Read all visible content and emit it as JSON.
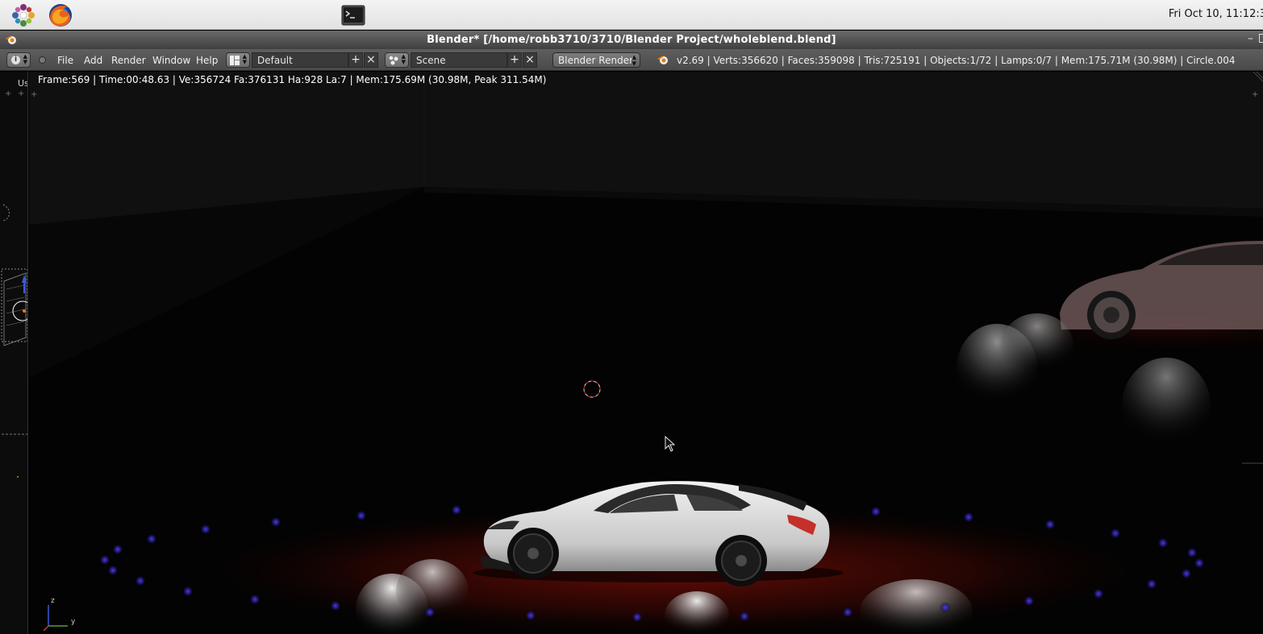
{
  "desktop": {
    "launchers": [
      "system-menu-icon",
      "firefox-icon",
      "terminal-icon"
    ],
    "clock": "Fri Oct 10, 11:12:3"
  },
  "window": {
    "title": "Blender* [/home/robb3710/3710/Blender Project/wholeblend.blend]"
  },
  "header": {
    "menus": [
      "File",
      "Add",
      "Render",
      "Window",
      "Help"
    ],
    "screen_layout": "Default",
    "scene": "Scene",
    "render_engine": "Blender Render",
    "stats": "v2.69 | Verts:356620 | Faces:359098 | Tris:725191 | Objects:1/72 | Lamps:0/7 | Mem:175.71M (30.98M) | Circle.004"
  },
  "viewport": {
    "render_info": "Frame:569 | Time:00:48.63 | Ve:356724 Fa:376131 Ha:928 La:7 | Mem:175.69M (30.98M, Peak 311.54M)",
    "axis_z": "z",
    "axis_y": "y"
  },
  "side_panel": {
    "label": "Us"
  },
  "colors": {
    "panel_bg": "#e8e8e8",
    "header_bg": "#545454",
    "floor_glow": "#5a0a06",
    "floor_lights": "#2a1f9e"
  }
}
